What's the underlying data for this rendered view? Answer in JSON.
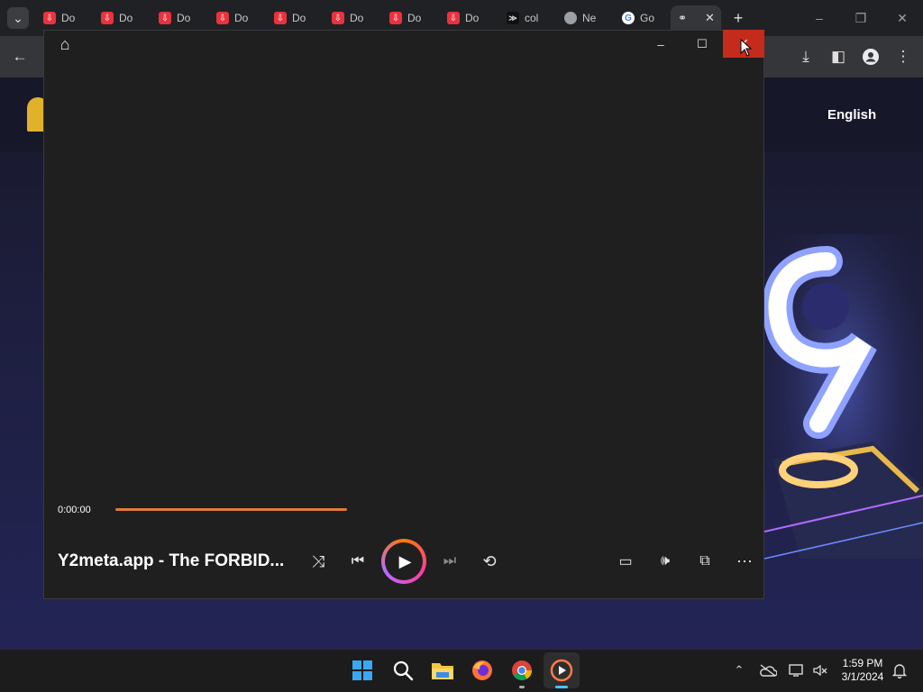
{
  "browser": {
    "tabs": [
      {
        "label": "Do",
        "icon": "download-icon"
      },
      {
        "label": "Do",
        "icon": "download-icon"
      },
      {
        "label": "Do",
        "icon": "download-icon"
      },
      {
        "label": "Do",
        "icon": "download-icon"
      },
      {
        "label": "Do",
        "icon": "download-icon"
      },
      {
        "label": "Do",
        "icon": "download-icon"
      },
      {
        "label": "Do",
        "icon": "download-icon"
      },
      {
        "label": "Do",
        "icon": "download-icon"
      },
      {
        "label": "col",
        "icon": "terminal-icon"
      },
      {
        "label": "Ne",
        "icon": "chrome-icon"
      },
      {
        "label": "Go",
        "icon": "google-icon"
      }
    ],
    "active_tab_icon": "loading-icon",
    "tab_glyphs": {
      "download": "⇩",
      "terminal": "≫",
      "google": "G",
      "close": "✕",
      "new": "+",
      "chevron": "⌄"
    },
    "window_glyphs": {
      "minimize": "–",
      "restore": "❐",
      "close": "✕"
    },
    "toolbar_glyphs": {
      "back": "←",
      "download": "⤓",
      "sidepanel": "◧",
      "menu": "⋮"
    }
  },
  "page": {
    "language": "English"
  },
  "player": {
    "title": "Y2meta.app - The FORBID...",
    "time": "0:00:00",
    "progress": 0,
    "glyphs": {
      "home": "⌂",
      "minimize": "–",
      "maximize": "☐",
      "close": "✕",
      "shuffle": "⤨",
      "previous": "⏮",
      "play": "▶",
      "next": "⏭",
      "repeat": "⟲",
      "subtitles": "▭",
      "volume": "🕪",
      "miniplayer": "⧉",
      "more": "⋯"
    }
  },
  "taskbar": {
    "time": "1:59 PM",
    "date": "3/1/2024",
    "glyphs": {
      "search": "⌕",
      "chevron_up": "⌃",
      "notification": "🔔"
    }
  },
  "colors": {
    "player_accent": "#e07a3a",
    "close_hover": "#c42b1c",
    "tab_favicon": "#e8333f"
  }
}
